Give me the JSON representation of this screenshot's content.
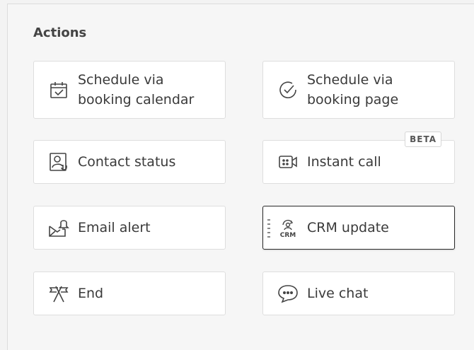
{
  "section": {
    "title": "Actions"
  },
  "actions": [
    {
      "label": "Schedule via booking calendar",
      "icon": "calendar-check-icon"
    },
    {
      "label": "Schedule via booking page",
      "icon": "check-circle-icon"
    },
    {
      "label": "Contact status",
      "icon": "contact-status-icon"
    },
    {
      "label": "Instant call",
      "icon": "video-call-icon",
      "badge": "BETA"
    },
    {
      "label": "Email alert",
      "icon": "email-bell-icon"
    },
    {
      "label": "CRM update",
      "icon": "crm-icon",
      "icon_text": "CRM",
      "selected": true
    },
    {
      "label": "End",
      "icon": "end-flags-icon"
    },
    {
      "label": "Live chat",
      "icon": "chat-bubble-icon"
    }
  ],
  "colors": {
    "background": "#f6f6f6",
    "card": "#ffffff",
    "card_border": "#dedede",
    "selected_border": "#2a2a2a",
    "text": "#3a3a3a"
  }
}
